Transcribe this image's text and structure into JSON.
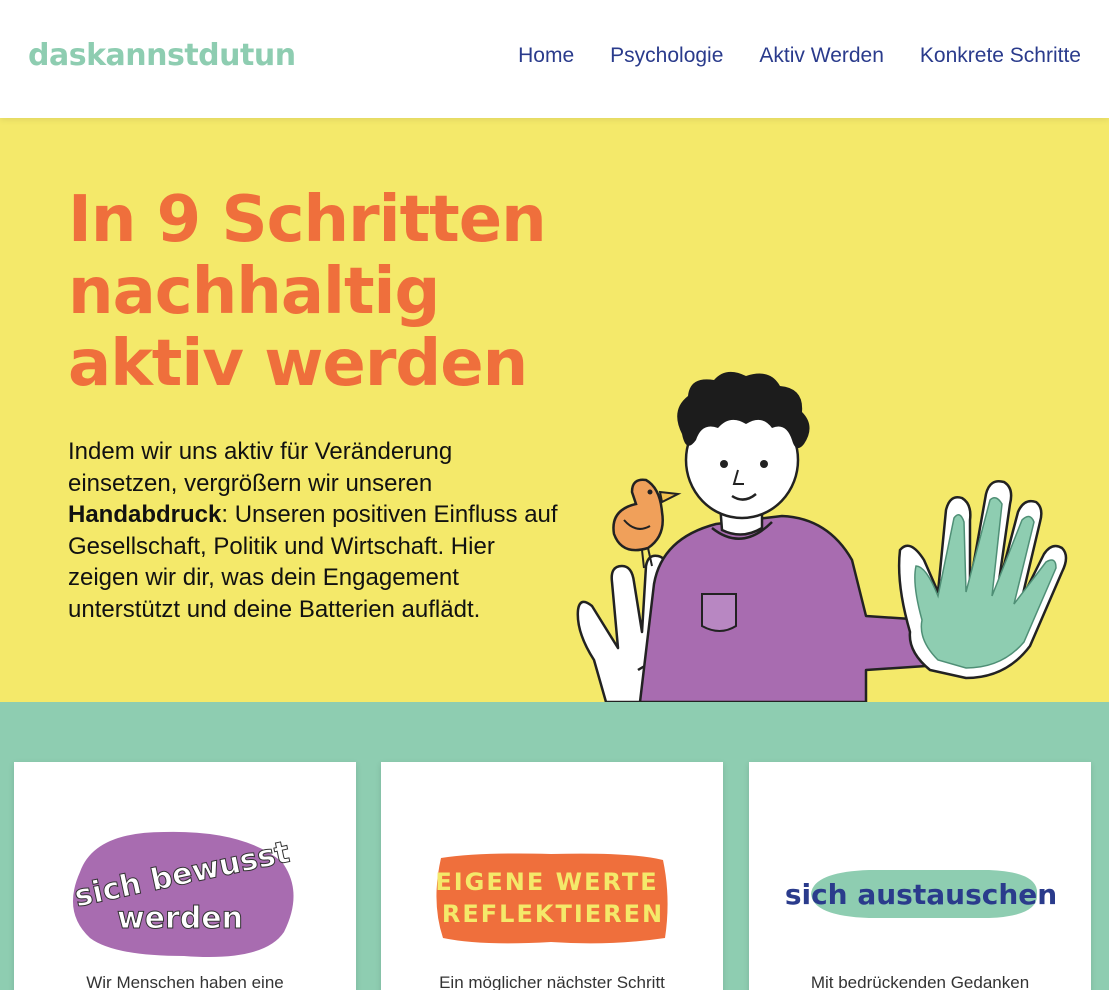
{
  "header": {
    "logo": "daskannstdutun",
    "nav": [
      "Home",
      "Psychologie",
      "Aktiv Werden",
      "Konkrete Schritte"
    ]
  },
  "hero": {
    "title_lines": [
      "In 9 Schritten",
      "nachhaltig",
      "aktiv werden"
    ],
    "intro_before": "Indem wir uns aktiv für Veränderung einsetzen, vergrößern wir unseren ",
    "intro_bold": "Handabdruck",
    "intro_after": ": Unseren positiven Einfluss auf Gesellschaft, Politik und Wirtschaft. Hier zeigen wir dir, was dein Engagement unterstützt und deine Batterien auflädt."
  },
  "cards": [
    {
      "badge": [
        "sich bewusst",
        "werden"
      ],
      "text": "Wir Menschen haben eine"
    },
    {
      "badge": [
        "EIGENE WERTE",
        "REFLEKTIEREN"
      ],
      "text": "Ein möglicher nächster Schritt"
    },
    {
      "badge": [
        "sich austauschen"
      ],
      "text": "Mit bedrückenden Gedanken"
    }
  ],
  "colors": {
    "logo": "#8ecdb1",
    "nav": "#2a3b8c",
    "hero_bg": "#f4e96a",
    "title": "#ef6f3c",
    "cards_bg": "#8ecdb1",
    "badge_purple": "#a86cb0",
    "badge_orange": "#ef6f3c",
    "badge_green": "#8ecdb1"
  },
  "icons": [
    "person-illustration-icon",
    "bird-icon",
    "handprint-icon"
  ]
}
